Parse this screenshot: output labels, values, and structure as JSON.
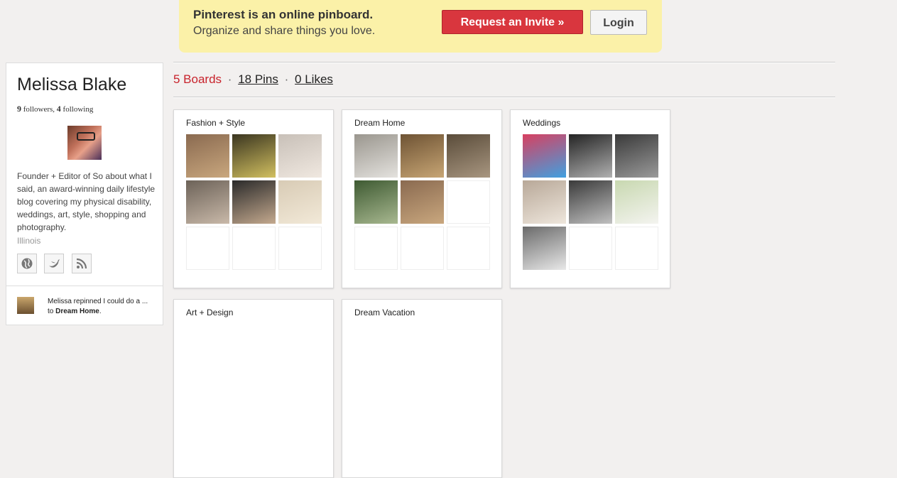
{
  "banner": {
    "headline": "Pinterest is an online pinboard.",
    "tagline": "Organize and share things you love.",
    "invite_label": "Request an Invite »",
    "login_label": "Login",
    "accent": "#d9363e"
  },
  "profile": {
    "name": "Melissa Blake",
    "followers": "9",
    "followers_label": "followers",
    "following": "4",
    "following_label": "following",
    "bio": "Founder + Editor of So about what I said, an award-winning daily lifestyle blog covering my physical disability, weddings, art, style, shopping and photography.",
    "location": "Illinois",
    "social_icons": [
      "globe-icon",
      "twitter-icon",
      "rss-icon"
    ]
  },
  "activity": {
    "text_prefix": "Melissa repinned I could do a ... to ",
    "board": "Dream Home",
    "suffix": "."
  },
  "stats": {
    "boards": "5 Boards",
    "pins": "18 Pins",
    "likes": "0 Likes",
    "separator": "·"
  },
  "boards": [
    {
      "title": "Fashion + Style",
      "thumbs": [
        [
          "#8a6a50",
          "#c9a77e"
        ],
        [
          "#3a3520",
          "#d2c060"
        ],
        [
          "#c8c0b8",
          "#f0e8e0"
        ],
        [
          "#6c6258",
          "#c9b9a9"
        ],
        [
          "#2a2a2a",
          "#c4a98e"
        ],
        [
          "#d8cbb5",
          "#f2e9d8"
        ]
      ]
    },
    {
      "title": "Dream Home",
      "thumbs": [
        [
          "#9a968e",
          "#e4e2de"
        ],
        [
          "#6e5334",
          "#c7a574"
        ],
        [
          "#5a4c3a",
          "#a89680"
        ],
        [
          "#3e5a32",
          "#a8b890"
        ],
        [
          "#8a6a50",
          "#c9a77e"
        ]
      ]
    },
    {
      "title": "Weddings",
      "thumbs": [
        [
          "#d84060",
          "#40a0e0"
        ],
        [
          "#242424",
          "#b0b0b0"
        ],
        [
          "#3a3a3a",
          "#9a9a9a"
        ],
        [
          "#b8a898",
          "#eee6dc"
        ],
        [
          "#3a3a3a",
          "#c0c0c0"
        ],
        [
          "#c8d8b0",
          "#f4f4f0"
        ],
        [
          "#6a6a6a",
          "#e8e8e8"
        ]
      ]
    },
    {
      "title": "Art + Design",
      "thumbs": []
    },
    {
      "title": "Dream Vacation",
      "thumbs": []
    }
  ]
}
